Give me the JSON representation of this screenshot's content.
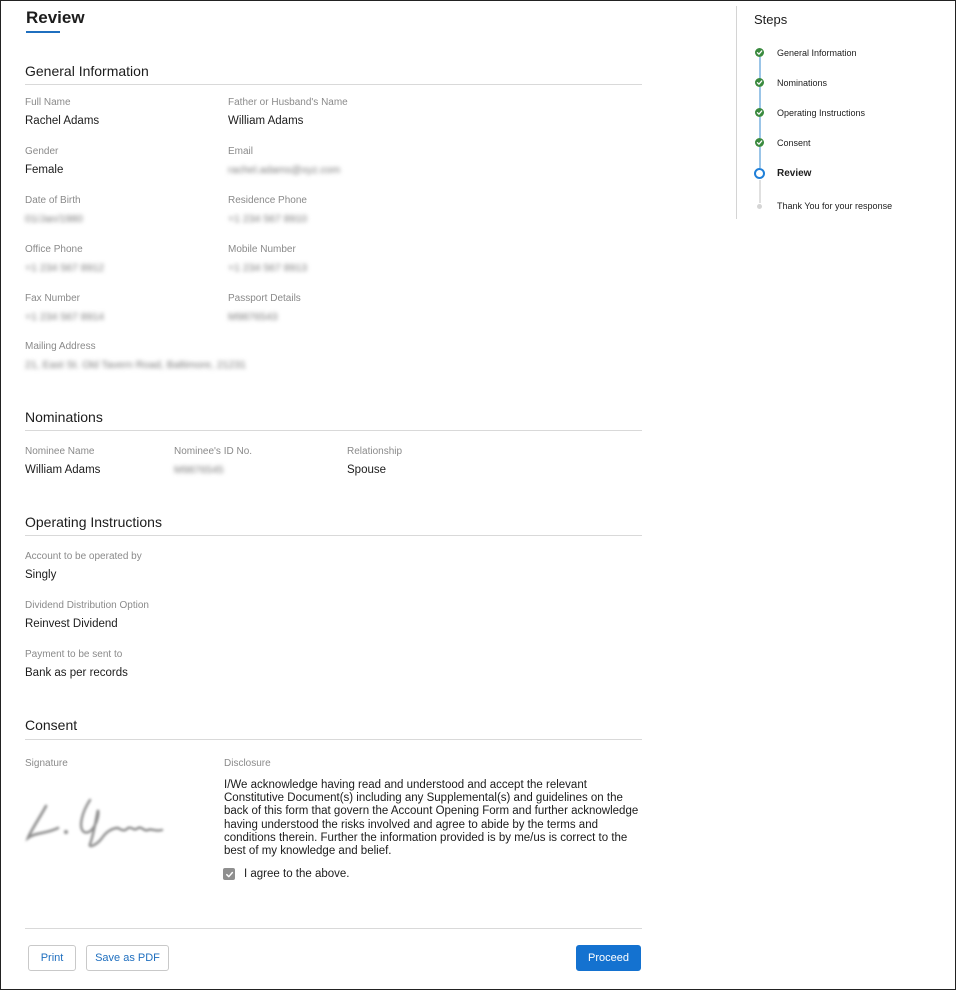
{
  "page_title": "Review",
  "general": {
    "title": "General Information",
    "full_name_label": "Full Name",
    "full_name": "Rachel Adams",
    "father_label": "Father or Husband's Name",
    "father": "William Adams",
    "gender_label": "Gender",
    "gender": "Female",
    "email_label": "Email",
    "email": "rachel.adams@xyz.com",
    "dob_label": "Date of Birth",
    "dob": "01/Jan/1980",
    "residence_phone_label": "Residence Phone",
    "residence_phone": "+1 234 567 8910",
    "office_phone_label": "Office Phone",
    "office_phone": "+1 234 567 8912",
    "mobile_label": "Mobile Number",
    "mobile": "+1 234 567 8913",
    "fax_label": "Fax Number",
    "fax": "+1 234 567 8914",
    "passport_label": "Passport Details",
    "passport": "M9876543",
    "mailing_label": "Mailing Address",
    "mailing": "21, East St. Old Tavern Road, Baltimore, 21231"
  },
  "nominations": {
    "title": "Nominations",
    "nominee_name_label": "Nominee Name",
    "nominee_name": "William Adams",
    "nominee_id_label": "Nominee's ID No.",
    "nominee_id": "M9876545",
    "relationship_label": "Relationship",
    "relationship": "Spouse"
  },
  "operating": {
    "title": "Operating Instructions",
    "operated_by_label": "Account to be operated by",
    "operated_by": "Singly",
    "dividend_label": "Dividend Distribution Option",
    "dividend": "Reinvest Dividend",
    "payment_label": "Payment to be sent to",
    "payment": "Bank as per records"
  },
  "consent": {
    "title": "Consent",
    "signature_label": "Signature",
    "disclosure_label": "Disclosure",
    "disclosure": "I/We acknowledge having read and understood and accept the relevant Constitutive Document(s) including any Supplemental(s) and guidelines on the back of this form that govern the Account Opening Form and further acknowledge having understood the risks involved and agree to abide by the terms and conditions therein. Further the information provided is by me/us is correct to the best of my knowledge and belief.",
    "agree_label": "I agree to the above.",
    "agree_checked": true
  },
  "buttons": {
    "print": "Print",
    "save_pdf": "Save as PDF",
    "proceed": "Proceed"
  },
  "steps": {
    "title": "Steps",
    "items": [
      {
        "label": "General Information",
        "status": "done",
        "icon": "check-circle-icon"
      },
      {
        "label": "Nominations",
        "status": "done",
        "icon": "check-circle-icon"
      },
      {
        "label": "Operating Instructions",
        "status": "done",
        "icon": "check-circle-icon"
      },
      {
        "label": "Consent",
        "status": "done",
        "icon": "check-circle-icon"
      },
      {
        "label": "Review",
        "status": "current",
        "icon": "current-step-icon"
      },
      {
        "label": "Thank You for your response",
        "status": "pending",
        "icon": "pending-step-icon"
      }
    ]
  },
  "colors": {
    "accent": "#1472d0",
    "done": "#3a8a3f"
  }
}
